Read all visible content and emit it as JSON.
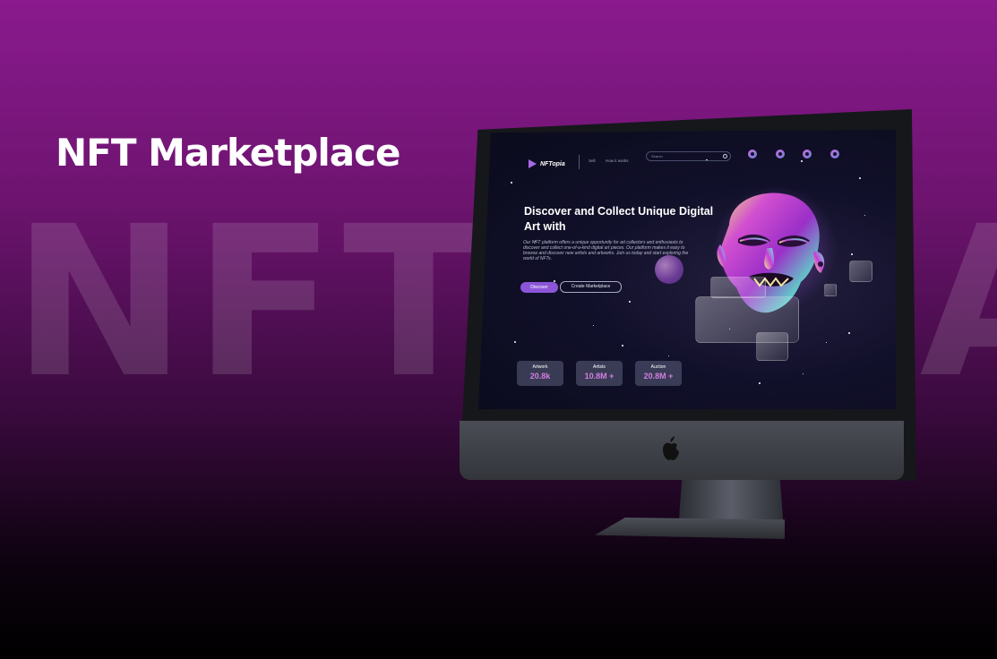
{
  "headline": "NFT Marketplace",
  "background_word": "NFTOPIA",
  "screen": {
    "brand": "NFTopia",
    "nav_links": [
      "Sell",
      "How it works"
    ],
    "search_placeholder": "Search",
    "hero": {
      "title": "Discover and Collect Unique Digital Art with",
      "description": "Our NFT platform offers a unique opportunity for art collectors and enthusiasts to discover and collect one-of-a-kind digital art pieces. Our platform makes it easy to browse and discover new artists and artworks. Join us today and start exploring the world of NFTs.",
      "discover_label": "Discover",
      "create_label": "Create Marketplace"
    },
    "stats": [
      {
        "label": "Artwork",
        "value": "20.8k"
      },
      {
        "label": "Artists",
        "value": "10.8M +"
      },
      {
        "label": "Auction",
        "value": "20.8M +"
      }
    ]
  },
  "colors": {
    "accent": "#8c55d8",
    "stat_value": "#d27fe0",
    "screen_bg": "#0a0b1c"
  }
}
